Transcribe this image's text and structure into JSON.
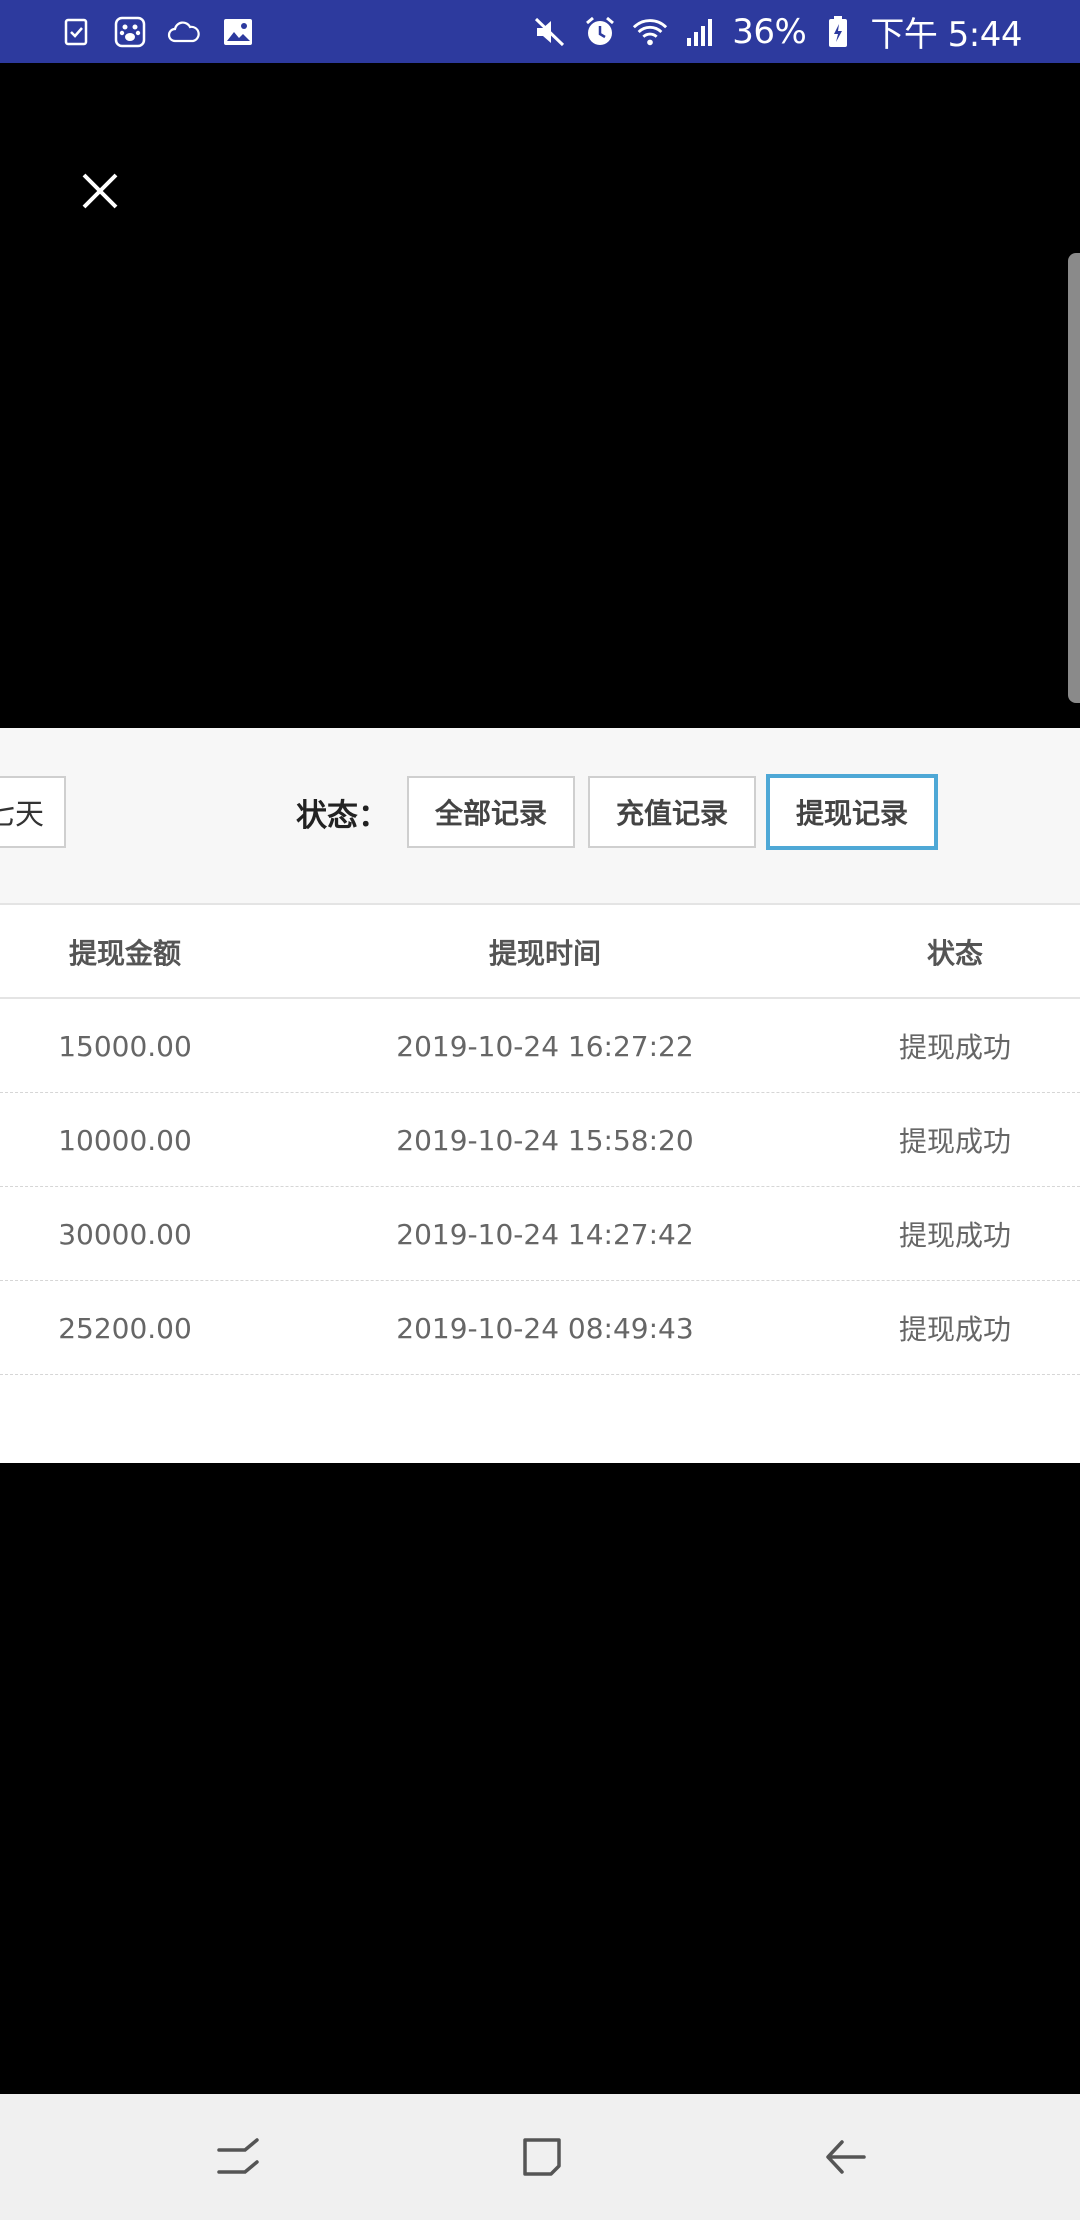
{
  "status_bar": {
    "battery": "36%",
    "time": "下午 5:44",
    "left_icons": [
      "checklist-icon",
      "paw-icon",
      "cloud-icon",
      "image-icon"
    ],
    "right_icons": [
      "mute-icon",
      "alarm-icon",
      "wifi-icon",
      "signal-icon",
      "battery-icon"
    ]
  },
  "viewer": {
    "close_icon": "close-icon"
  },
  "filter": {
    "date_chip": "七天",
    "status_label": "状态：",
    "buttons": [
      {
        "label": "全部记录",
        "active": false
      },
      {
        "label": "充值记录",
        "active": false
      },
      {
        "label": "提现记录",
        "active": true
      }
    ],
    "active_color": "#4ea8d6"
  },
  "table": {
    "headers": [
      "提现金额",
      "提现时间",
      "状态"
    ],
    "rows": [
      {
        "amount": "15000.00",
        "time": "2019-10-24 16:27:22",
        "status": "提现成功"
      },
      {
        "amount": "10000.00",
        "time": "2019-10-24 15:58:20",
        "status": "提现成功"
      },
      {
        "amount": "30000.00",
        "time": "2019-10-24 14:27:42",
        "status": "提现成功"
      },
      {
        "amount": "25200.00",
        "time": "2019-10-24 08:49:43",
        "status": "提现成功"
      }
    ]
  },
  "nav": {
    "buttons": [
      "recents-icon",
      "home-icon",
      "back-icon"
    ]
  }
}
